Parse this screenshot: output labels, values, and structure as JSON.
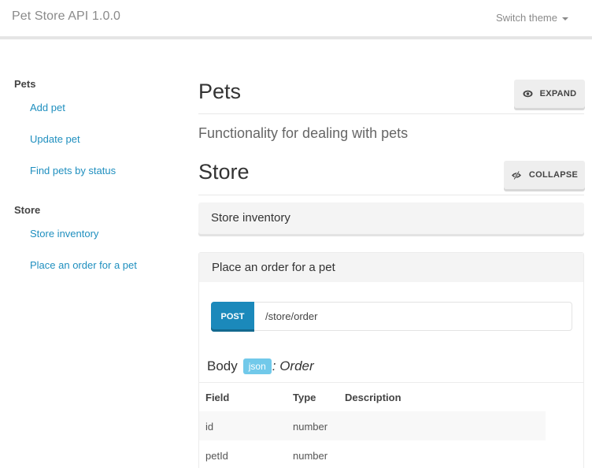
{
  "header": {
    "title": "Pet Store API 1.0.0",
    "theme_switch_label": "Switch theme"
  },
  "sidebar": {
    "groups": [
      {
        "label": "Pets",
        "items": [
          {
            "label": "Add pet"
          },
          {
            "label": "Update pet"
          },
          {
            "label": "Find pets by status"
          }
        ]
      },
      {
        "label": "Store",
        "items": [
          {
            "label": "Store inventory"
          },
          {
            "label": "Place an order for a pet"
          }
        ]
      }
    ]
  },
  "main": {
    "sections": [
      {
        "title": "Pets",
        "toggle_label": "EXPAND",
        "toggle_icon": "eye-icon",
        "description": "Functionality for dealing with pets"
      },
      {
        "title": "Store",
        "toggle_label": "COLLAPSE",
        "toggle_icon": "eye-slash-icon",
        "operations": [
          {
            "title": "Store inventory",
            "expanded": false
          },
          {
            "title": "Place an order for a pet",
            "expanded": true,
            "method": "POST",
            "path": "/store/order",
            "body": {
              "label": "Body",
              "content_type": "json",
              "schema": ": Order",
              "columns": [
                "Field",
                "Type",
                "Description"
              ],
              "rows": [
                {
                  "field": "id",
                  "type": "number",
                  "description": ""
                },
                {
                  "field": "petId",
                  "type": "number",
                  "description": ""
                }
              ]
            }
          }
        ]
      }
    ]
  },
  "colors": {
    "link": "#1f8fbf",
    "post_method": "#1b89bb",
    "json_badge": "#71c9ea",
    "panel_bg": "#f4f4f4",
    "button_bg": "#eeeeee"
  }
}
